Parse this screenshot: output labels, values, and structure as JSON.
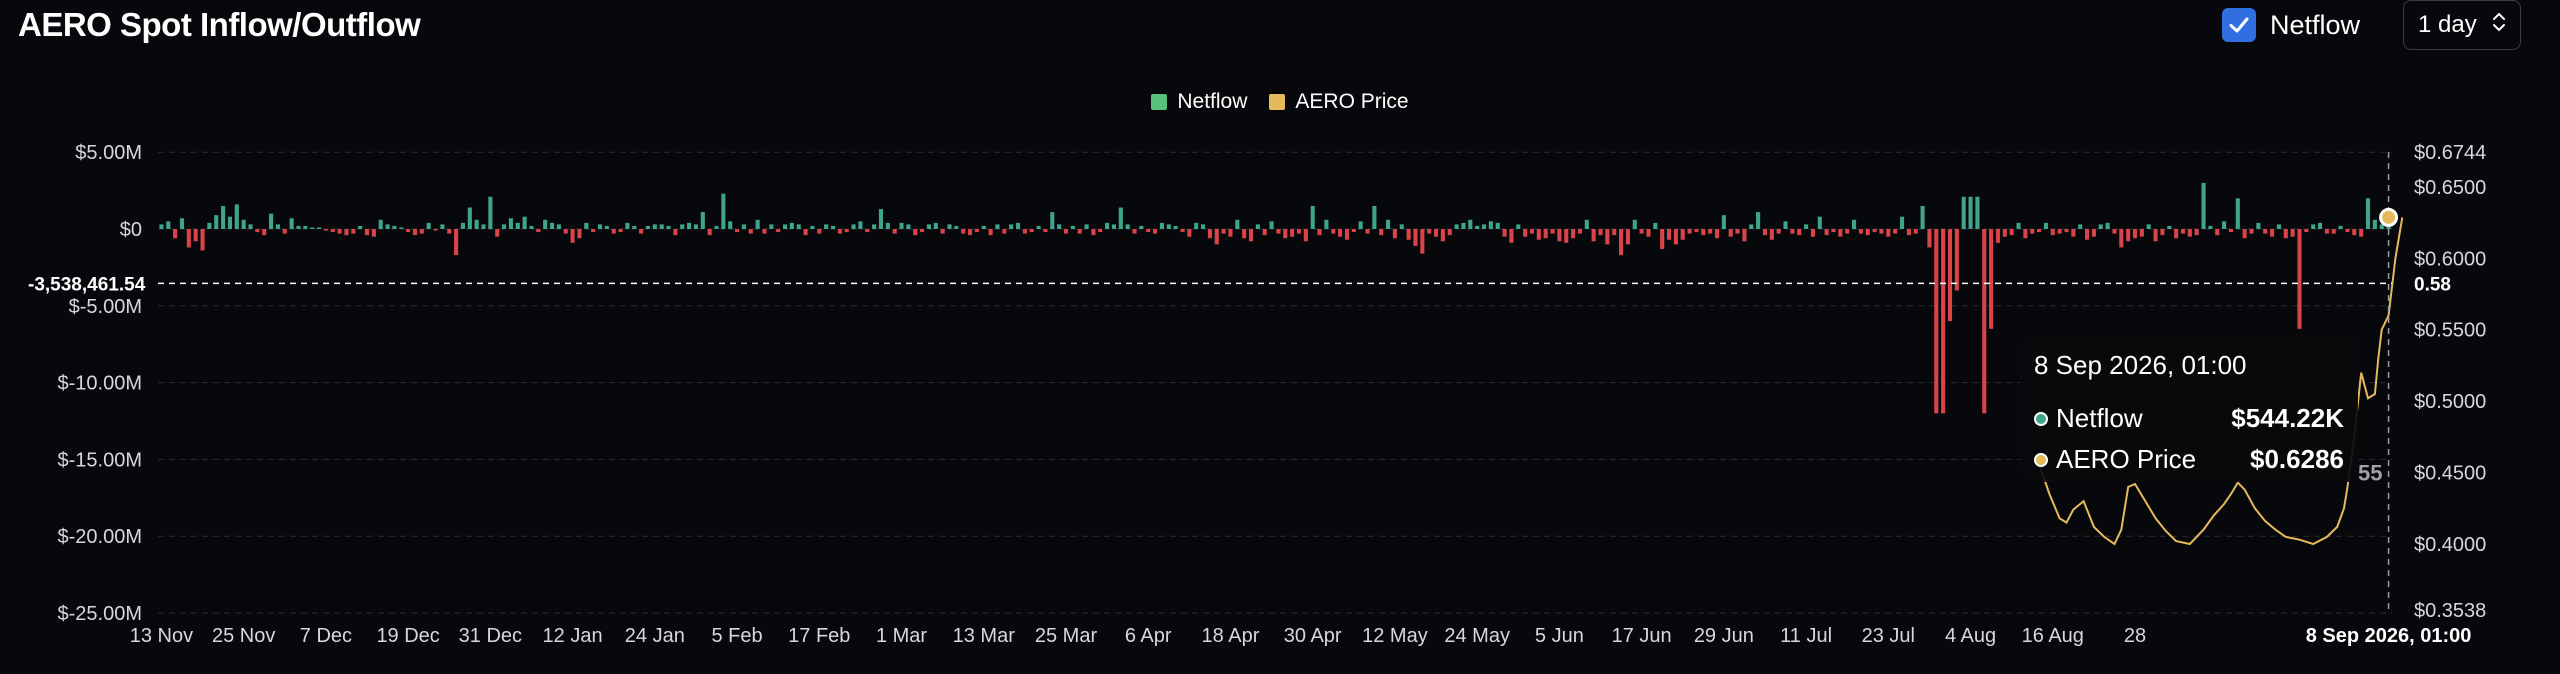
{
  "header": {
    "title": "AERO Spot Inflow/Outflow",
    "netflow_toggle_label": "Netflow",
    "netflow_toggle_checked": true,
    "interval_value": "1 day"
  },
  "colors": {
    "positive": "#3fa58a",
    "negative": "#d94448",
    "price": "#e5b95c",
    "legend_netflow": "#58c27d",
    "legend_price": "#e5b95c",
    "background": "#07080b",
    "checkbox": "#2f6fe0"
  },
  "crosshair": {
    "left_value_label": "-3,538,461.54",
    "right_value_label": "0.58",
    "x_label": "8 Sep 2026, 01:00"
  },
  "tooltip": {
    "date": "8 Sep 2026, 01:00",
    "rows": [
      {
        "name": "Netflow",
        "value": "$544.22K"
      },
      {
        "name": "AERO Price",
        "value": "$0.6286"
      }
    ],
    "overflow_text": "55"
  },
  "chart_data": {
    "type": "bar",
    "legend": [
      {
        "name": "Netflow",
        "color": "#58c27d"
      },
      {
        "name": "AERO Price",
        "color": "#e5b95c"
      }
    ],
    "left_axis": {
      "label_ticks": [
        "$5.00M",
        "$0",
        "$-5.00M",
        "$-10.00M",
        "$-15.00M",
        "$-20.00M",
        "$-25.00M"
      ],
      "tick_values": [
        5,
        0,
        -5,
        -10,
        -15,
        -20,
        -25
      ],
      "unit": "M",
      "range": [
        -25,
        5
      ]
    },
    "right_axis": {
      "label_ticks": [
        "$0.6744",
        "$0.6500",
        "$0.6000",
        "$0.5500",
        "$0.5000",
        "$0.4500",
        "$0.4000",
        "$0.3538"
      ],
      "tick_values": [
        0.6744,
        0.65,
        0.6,
        0.55,
        0.5,
        0.45,
        0.4,
        0.3538
      ],
      "range": [
        0.3538,
        0.6744
      ]
    },
    "x_axis_labels": [
      "13 Nov",
      "25 Nov",
      "7 Dec",
      "19 Dec",
      "31 Dec",
      "12 Jan",
      "24 Jan",
      "5 Feb",
      "17 Feb",
      "1 Mar",
      "13 Mar",
      "25 Mar",
      "6 Apr",
      "18 Apr",
      "30 Apr",
      "12 May",
      "24 May",
      "5 Jun",
      "17 Jun",
      "29 Jun",
      "11 Jul",
      "23 Jul",
      "4 Aug",
      "16 Aug",
      "28"
    ],
    "grid": true,
    "netflow_millions": [
      0.3,
      0.5,
      -0.6,
      0.7,
      -1.2,
      -0.8,
      -1.4,
      0.4,
      0.9,
      1.5,
      0.8,
      1.6,
      0.6,
      0.3,
      -0.2,
      -0.4,
      1.0,
      0.3,
      -0.3,
      0.7,
      0.2,
      0.2,
      0.1,
      0.1,
      -0.1,
      -0.2,
      -0.3,
      -0.4,
      -0.3,
      0.2,
      -0.4,
      -0.5,
      0.6,
      0.3,
      0.2,
      0.1,
      -0.2,
      -0.4,
      -0.3,
      0.4,
      -0.1,
      0.3,
      -0.3,
      -1.7,
      0.4,
      1.4,
      0.6,
      0.3,
      2.1,
      -0.5,
      0.3,
      0.7,
      0.4,
      0.8,
      0.2,
      -0.2,
      0.6,
      0.4,
      0.3,
      -0.3,
      -0.9,
      -0.6,
      0.4,
      -0.2,
      0.3,
      0.2,
      -0.3,
      -0.2,
      0.4,
      0.2,
      -0.3,
      0.2,
      0.3,
      0.3,
      0.2,
      -0.4,
      0.3,
      0.4,
      0.3,
      1.1,
      -0.4,
      0.2,
      2.3,
      0.5,
      -0.2,
      0.3,
      -0.3,
      0.6,
      -0.3,
      0.3,
      -0.2,
      0.3,
      0.4,
      0.3,
      -0.4,
      0.2,
      -0.3,
      0.3,
      0.2,
      -0.3,
      -0.2,
      0.3,
      0.5,
      -0.2,
      0.3,
      1.3,
      0.4,
      -0.3,
      0.4,
      0.3,
      -0.4,
      -0.2,
      0.3,
      0.4,
      -0.3,
      0.3,
      0.2,
      -0.3,
      -0.4,
      -0.2,
      0.2,
      -0.4,
      0.3,
      -0.3,
      0.3,
      0.4,
      -0.3,
      -0.2,
      0.2,
      -0.2,
      1.1,
      0.3,
      -0.3,
      0.2,
      -0.3,
      0.3,
      -0.4,
      -0.2,
      0.4,
      0.3,
      1.4,
      0.3,
      -0.3,
      0.2,
      -0.2,
      -0.3,
      0.4,
      0.3,
      0.2,
      -0.2,
      -0.5,
      0.4,
      0.3,
      -0.6,
      -1.0,
      -0.3,
      -0.5,
      0.6,
      -0.6,
      -0.8,
      0.3,
      -0.4,
      0.5,
      -0.3,
      -0.6,
      -0.5,
      -0.3,
      -0.8,
      1.5,
      -0.4,
      0.6,
      -0.3,
      -0.5,
      -0.7,
      -0.2,
      0.5,
      -0.3,
      1.5,
      -0.4,
      0.6,
      -0.6,
      0.3,
      -0.7,
      -1.1,
      -1.6,
      -0.3,
      -0.5,
      -0.8,
      -0.4,
      0.3,
      0.4,
      0.6,
      0.2,
      0.3,
      0.5,
      0.4,
      -0.5,
      -0.9,
      0.3,
      -0.5,
      -0.3,
      -0.7,
      -0.6,
      -0.3,
      -0.8,
      -0.9,
      -0.6,
      -0.3,
      0.6,
      -0.8,
      -0.4,
      -1.0,
      -0.4,
      -1.7,
      -1.0,
      0.6,
      -0.3,
      -0.5,
      0.4,
      -1.3,
      -0.7,
      -1.0,
      -0.7,
      -0.3,
      -0.2,
      -0.4,
      -0.3,
      -0.6,
      0.9,
      -0.5,
      -0.3,
      -0.8,
      0.3,
      1.1,
      -0.4,
      -0.7,
      -0.3,
      0.5,
      -0.3,
      -0.4,
      0.3,
      -0.5,
      0.8,
      -0.4,
      -0.2,
      -0.5,
      -0.3,
      0.6,
      -0.3,
      -0.4,
      -0.2,
      -0.3,
      -0.5,
      -0.3,
      0.8,
      -0.4,
      -0.3,
      1.5,
      -1.2,
      -12.0,
      -12.0,
      -6.0,
      -4.0,
      2.1,
      2.1,
      2.1,
      -12.0,
      -6.5,
      -0.9,
      -0.5,
      -0.4,
      0.4,
      -0.6,
      -0.3,
      -0.2,
      0.4,
      -0.4,
      -0.3,
      -0.2,
      -0.5,
      0.3,
      -0.7,
      -0.5,
      0.3,
      0.4,
      -0.3,
      -1.2,
      -0.8,
      -0.6,
      -0.5,
      0.3,
      -0.8,
      -0.4,
      0.2,
      -0.6,
      -0.3,
      -0.5,
      -0.4,
      3.0,
      0.2,
      -0.4,
      0.5,
      -0.2,
      2.0,
      -0.6,
      -0.3,
      0.4,
      -0.3,
      -0.5,
      0.3,
      -0.6,
      -0.5,
      -6.5,
      -0.2,
      0.3,
      0.4,
      -0.3,
      -0.3,
      0.2,
      -0.2,
      -0.4,
      -0.5,
      2.0,
      0.6,
      0.3,
      0.544
    ],
    "price_series": [
      {
        "xi": 274,
        "y": 0.456
      },
      {
        "xi": 275.5,
        "y": 0.435
      },
      {
        "xi": 277,
        "y": 0.418
      },
      {
        "xi": 278,
        "y": 0.415
      },
      {
        "xi": 279,
        "y": 0.424
      },
      {
        "xi": 280.5,
        "y": 0.43
      },
      {
        "xi": 282,
        "y": 0.412
      },
      {
        "xi": 283.5,
        "y": 0.405
      },
      {
        "xi": 285,
        "y": 0.4
      },
      {
        "xi": 286,
        "y": 0.41
      },
      {
        "xi": 287,
        "y": 0.44
      },
      {
        "xi": 288,
        "y": 0.442
      },
      {
        "xi": 289.5,
        "y": 0.43
      },
      {
        "xi": 291,
        "y": 0.418
      },
      {
        "xi": 292.5,
        "y": 0.409
      },
      {
        "xi": 294,
        "y": 0.402
      },
      {
        "xi": 296,
        "y": 0.4
      },
      {
        "xi": 298,
        "y": 0.41
      },
      {
        "xi": 299.5,
        "y": 0.42
      },
      {
        "xi": 301,
        "y": 0.428
      },
      {
        "xi": 302,
        "y": 0.435
      },
      {
        "xi": 303,
        "y": 0.443
      },
      {
        "xi": 304,
        "y": 0.438
      },
      {
        "xi": 305.5,
        "y": 0.425
      },
      {
        "xi": 307,
        "y": 0.416
      },
      {
        "xi": 308.5,
        "y": 0.41
      },
      {
        "xi": 310,
        "y": 0.405
      },
      {
        "xi": 312,
        "y": 0.403
      },
      {
        "xi": 314,
        "y": 0.4
      },
      {
        "xi": 316,
        "y": 0.405
      },
      {
        "xi": 317.5,
        "y": 0.412
      },
      {
        "xi": 318.5,
        "y": 0.425
      },
      {
        "xi": 319,
        "y": 0.44
      },
      {
        "xi": 320,
        "y": 0.475
      },
      {
        "xi": 321,
        "y": 0.52
      },
      {
        "xi": 322,
        "y": 0.502
      },
      {
        "xi": 323,
        "y": 0.505
      },
      {
        "xi": 323.5,
        "y": 0.53
      },
      {
        "xi": 324,
        "y": 0.55
      },
      {
        "xi": 325,
        "y": 0.56
      },
      {
        "xi": 326,
        "y": 0.6
      },
      {
        "xi": 327,
        "y": 0.6286
      }
    ]
  }
}
